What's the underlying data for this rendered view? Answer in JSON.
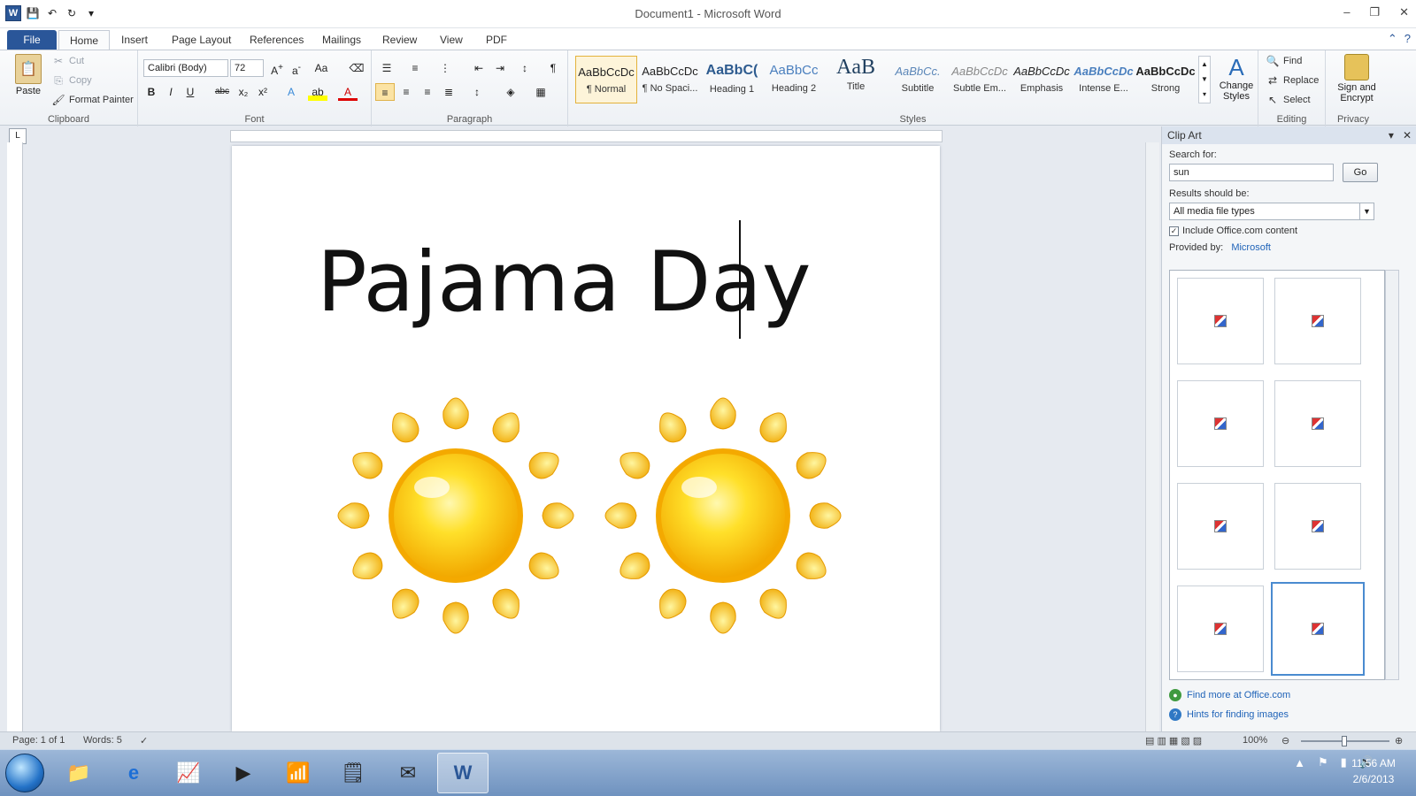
{
  "window": {
    "title": "Document1 - Microsoft Word"
  },
  "tabs": [
    "File",
    "Home",
    "Insert",
    "Page Layout",
    "References",
    "Mailings",
    "Review",
    "View",
    "PDF"
  ],
  "ribbon": {
    "clipboard": {
      "paste": "Paste",
      "cut": "Cut",
      "copy": "Copy",
      "format_painter": "Format Painter",
      "label": "Clipboard"
    },
    "font": {
      "name": "Calibri (Body)",
      "size": "72",
      "label": "Font"
    },
    "paragraph": {
      "label": "Paragraph"
    },
    "styles": {
      "label": "Styles",
      "items": [
        {
          "sample": "AaBbCcDc",
          "name": "¶ Normal"
        },
        {
          "sample": "AaBbCcDc",
          "name": "¶ No Spaci..."
        },
        {
          "sample": "AaBbC(",
          "name": "Heading 1"
        },
        {
          "sample": "AaBbCc",
          "name": "Heading 2"
        },
        {
          "sample": "AaB",
          "name": "Title"
        },
        {
          "sample": "AaBbCc.",
          "name": "Subtitle"
        },
        {
          "sample": "AaBbCcDc",
          "name": "Subtle Em..."
        },
        {
          "sample": "AaBbCcDc",
          "name": "Emphasis"
        },
        {
          "sample": "AaBbCcDc",
          "name": "Intense E..."
        },
        {
          "sample": "AaBbCcDc",
          "name": "Strong"
        }
      ],
      "change_styles": "Change Styles"
    },
    "editing": {
      "find": "Find",
      "replace": "Replace",
      "select": "Select",
      "label": "Editing"
    },
    "privacy": {
      "sign": "Sign and Encrypt",
      "label": "Privacy"
    }
  },
  "document": {
    "heading": "Pajama Day"
  },
  "clipart": {
    "title": "Clip Art",
    "search_label": "Search for:",
    "search_value": "sun",
    "go": "Go",
    "results_label": "Results should be:",
    "results_value": "All media file types",
    "include_office": "Include Office.com content",
    "provided_by": "Provided by:",
    "provider": "Microsoft",
    "find_more": "Find more at Office.com",
    "hints": "Hints for finding images"
  },
  "status": {
    "page": "Page: 1 of 1",
    "words": "Words: 5",
    "zoom": "100%"
  },
  "clock": {
    "time": "11:56 AM",
    "date": "2/6/2013"
  }
}
